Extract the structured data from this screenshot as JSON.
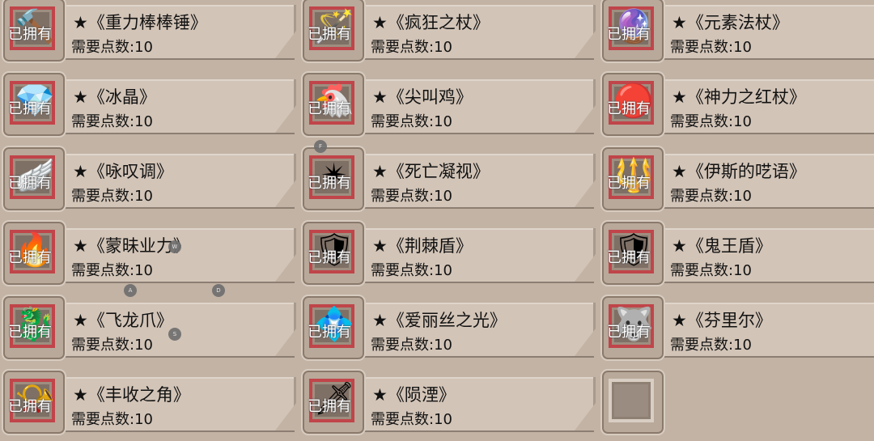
{
  "owned_label": "已拥有",
  "rows": [
    [
      {
        "name": "★《重力棒棒锤》",
        "points": "需要点数:10",
        "icon": "mace-icon",
        "glyph": "🔨",
        "owned": true
      },
      {
        "name": "★《疯狂之杖》",
        "points": "需要点数:10",
        "icon": "staff-icon",
        "glyph": "🪄",
        "owned": true
      },
      {
        "name": "★《元素法杖》",
        "points": "需要点数:10",
        "icon": "orb-staff-icon",
        "glyph": "🔮",
        "owned": true
      }
    ],
    [
      {
        "name": "★《冰晶》",
        "points": "需要点数:10",
        "icon": "ice-crystal-icon",
        "glyph": "💎",
        "owned": true
      },
      {
        "name": "★《尖叫鸡》",
        "points": "需要点数:10",
        "icon": "rubber-chicken-icon",
        "glyph": "🐔",
        "owned": true
      },
      {
        "name": "★《神力之红杖》",
        "points": "需要点数:10",
        "icon": "red-scepter-icon",
        "glyph": "🔴",
        "owned": true
      }
    ],
    [
      {
        "name": "★《咏叹调》",
        "points": "需要点数:10",
        "icon": "winged-staff-icon",
        "glyph": "🪽",
        "owned": true
      },
      {
        "name": "★《死亡凝视》",
        "points": "需要点数:10",
        "icon": "shuriken-icon",
        "glyph": "✴",
        "owned": true
      },
      {
        "name": "★《伊斯的呓语》",
        "points": "需要点数:10",
        "icon": "trident-icon",
        "glyph": "🔱",
        "owned": true
      }
    ],
    [
      {
        "name": "★《蒙昧业力》",
        "points": "需要点数:10",
        "icon": "fire-staff-icon",
        "glyph": "🔥",
        "owned": true
      },
      {
        "name": "★《荆棘盾》",
        "points": "需要点数:10",
        "icon": "thorn-shield-icon",
        "glyph": "🛡",
        "owned": true
      },
      {
        "name": "★《鬼王盾》",
        "points": "需要点数:10",
        "icon": "demon-shield-icon",
        "glyph": "🛡",
        "owned": true
      }
    ],
    [
      {
        "name": "★《飞龙爪》",
        "points": "需要点数:10",
        "icon": "dragon-claw-icon",
        "glyph": "🐉",
        "owned": true
      },
      {
        "name": "★《爱丽丝之光》",
        "points": "需要点数:10",
        "icon": "light-shield-icon",
        "glyph": "💠",
        "owned": true
      },
      {
        "name": "★《芬里尔》",
        "points": "需要点数:10",
        "icon": "wolf-shield-icon",
        "glyph": "🐺",
        "owned": true
      }
    ],
    [
      {
        "name": "★《丰收之角》",
        "points": "需要点数:10",
        "icon": "cornucopia-icon",
        "glyph": "📯",
        "owned": true
      },
      {
        "name": "★《陨湮》",
        "points": "需要点数:10",
        "icon": "meteor-sword-icon",
        "glyph": "🗡",
        "owned": true
      },
      {
        "name": "",
        "points": "",
        "icon": "empty-slot-icon",
        "glyph": "",
        "owned": false
      }
    ]
  ],
  "hints": [
    {
      "label": "F"
    },
    {
      "label": "W"
    },
    {
      "label": "A"
    },
    {
      "label": "D"
    },
    {
      "label": "S"
    }
  ]
}
